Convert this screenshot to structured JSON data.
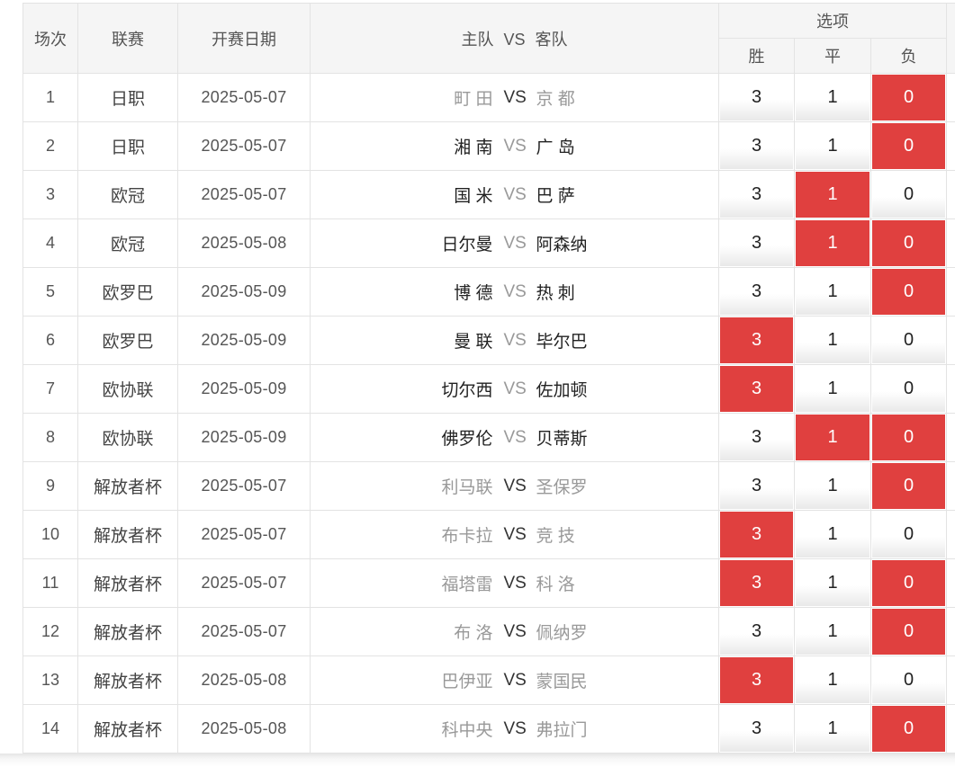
{
  "header": {
    "no": "场次",
    "league": "联赛",
    "date": "开赛日期",
    "match": "主队 VS 客队",
    "options": "选项",
    "win": "胜",
    "draw": "平",
    "lose": "负"
  },
  "rows": [
    {
      "no": "1",
      "league": "日职",
      "date": "2025-05-07",
      "home": "町 田",
      "vs": "VS",
      "away": "京 都",
      "win": "3",
      "draw": "1",
      "lose": "0",
      "style": "muted-vsdark",
      "sel": [
        false,
        false,
        true
      ]
    },
    {
      "no": "2",
      "league": "日职",
      "date": "2025-05-07",
      "home": "湘 南",
      "vs": "VS",
      "away": "广 岛",
      "win": "3",
      "draw": "1",
      "lose": "0",
      "style": "active",
      "sel": [
        false,
        false,
        true
      ]
    },
    {
      "no": "3",
      "league": "欧冠",
      "date": "2025-05-07",
      "home": "国 米",
      "vs": "VS",
      "away": "巴 萨",
      "win": "3",
      "draw": "1",
      "lose": "0",
      "style": "active",
      "sel": [
        false,
        true,
        false
      ]
    },
    {
      "no": "4",
      "league": "欧冠",
      "date": "2025-05-08",
      "home": "日尔曼",
      "vs": "VS",
      "away": "阿森纳",
      "win": "3",
      "draw": "1",
      "lose": "0",
      "style": "active",
      "sel": [
        false,
        true,
        true
      ]
    },
    {
      "no": "5",
      "league": "欧罗巴",
      "date": "2025-05-09",
      "home": "博 德",
      "vs": "VS",
      "away": "热 刺",
      "win": "3",
      "draw": "1",
      "lose": "0",
      "style": "active",
      "sel": [
        false,
        false,
        true
      ]
    },
    {
      "no": "6",
      "league": "欧罗巴",
      "date": "2025-05-09",
      "home": "曼 联",
      "vs": "VS",
      "away": "毕尔巴",
      "win": "3",
      "draw": "1",
      "lose": "0",
      "style": "active",
      "sel": [
        true,
        false,
        false
      ]
    },
    {
      "no": "7",
      "league": "欧协联",
      "date": "2025-05-09",
      "home": "切尔西",
      "vs": "VS",
      "away": "佐加顿",
      "win": "3",
      "draw": "1",
      "lose": "0",
      "style": "active",
      "sel": [
        true,
        false,
        false
      ]
    },
    {
      "no": "8",
      "league": "欧协联",
      "date": "2025-05-09",
      "home": "佛罗伦",
      "vs": "VS",
      "away": "贝蒂斯",
      "win": "3",
      "draw": "1",
      "lose": "0",
      "style": "active",
      "sel": [
        false,
        true,
        true
      ]
    },
    {
      "no": "9",
      "league": "解放者杯",
      "date": "2025-05-07",
      "home": "利马联",
      "vs": "VS",
      "away": "圣保罗",
      "win": "3",
      "draw": "1",
      "lose": "0",
      "style": "muted-vsdark",
      "sel": [
        false,
        false,
        true
      ]
    },
    {
      "no": "10",
      "league": "解放者杯",
      "date": "2025-05-07",
      "home": "布卡拉",
      "vs": "VS",
      "away": "竞 技",
      "win": "3",
      "draw": "1",
      "lose": "0",
      "style": "muted-vsdark",
      "sel": [
        true,
        false,
        false
      ]
    },
    {
      "no": "11",
      "league": "解放者杯",
      "date": "2025-05-07",
      "home": "福塔雷",
      "vs": "VS",
      "away": "科 洛",
      "win": "3",
      "draw": "1",
      "lose": "0",
      "style": "muted-vsdark",
      "sel": [
        true,
        false,
        true
      ]
    },
    {
      "no": "12",
      "league": "解放者杯",
      "date": "2025-05-07",
      "home": "布 洛",
      "vs": "VS",
      "away": "佩纳罗",
      "win": "3",
      "draw": "1",
      "lose": "0",
      "style": "muted-vsdark",
      "sel": [
        false,
        false,
        true
      ]
    },
    {
      "no": "13",
      "league": "解放者杯",
      "date": "2025-05-08",
      "home": "巴伊亚",
      "vs": "VS",
      "away": "蒙国民",
      "win": "3",
      "draw": "1",
      "lose": "0",
      "style": "muted-vsdark",
      "sel": [
        true,
        false,
        false
      ]
    },
    {
      "no": "14",
      "league": "解放者杯",
      "date": "2025-05-08",
      "home": "科中央",
      "vs": "VS",
      "away": "弗拉门",
      "win": "3",
      "draw": "1",
      "lose": "0",
      "style": "muted-vsdark",
      "sel": [
        false,
        false,
        true
      ]
    }
  ],
  "colors": {
    "selected": "#e0403f",
    "header_bg": "#f5f5f5",
    "border": "#e3e3e3"
  }
}
